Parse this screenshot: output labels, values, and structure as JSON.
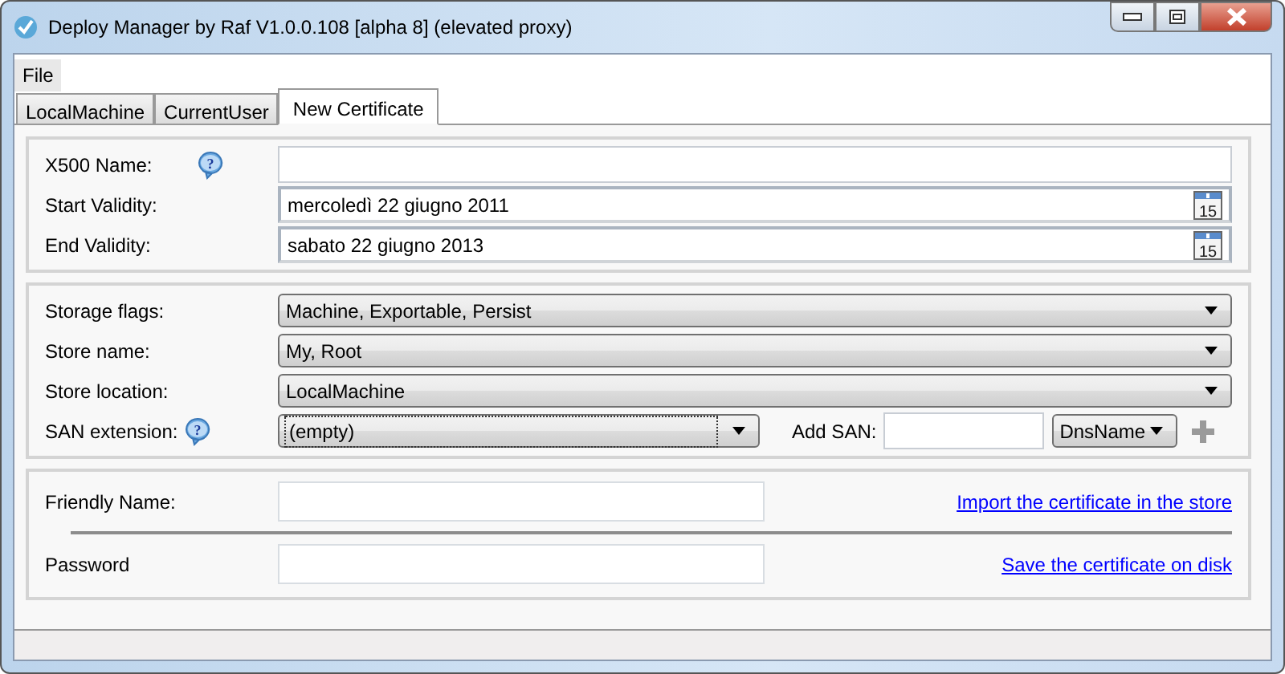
{
  "window": {
    "title": "Deploy Manager by Raf V1.0.0.108 [alpha 8] (elevated proxy)"
  },
  "menu": [
    "File"
  ],
  "tabs": [
    {
      "label": "LocalMachine",
      "selected": false
    },
    {
      "label": "CurrentUser",
      "selected": false
    },
    {
      "label": "New Certificate",
      "selected": true
    }
  ],
  "identity": [
    {
      "kind": "text",
      "label": "X500 Name:",
      "help": "?"
    },
    {
      "kind": "date",
      "label": "Start Validity:",
      "value": "mercoledì 22 giugno 2011",
      "calendar_day": "15"
    },
    {
      "kind": "date",
      "label": "End Validity:",
      "value": "sabato 22 giugno 2013",
      "calendar_day": "15"
    }
  ],
  "storage": [
    {
      "label": "Storage flags:",
      "value": "Machine, Exportable, Persist"
    },
    {
      "label": "Store name:",
      "value": "My, Root"
    },
    {
      "label": "Store location:",
      "value": "LocalMachine"
    }
  ],
  "san": {
    "label": "SAN extension:",
    "help": "?",
    "value": "(empty)",
    "focused": true,
    "add_label": "Add SAN:",
    "type": "DnsName"
  },
  "output": [
    {
      "label": "Friendly Name:",
      "link": "Import the certificate in the store"
    },
    {
      "label": "Password",
      "link": "Save the certificate on disk"
    }
  ]
}
